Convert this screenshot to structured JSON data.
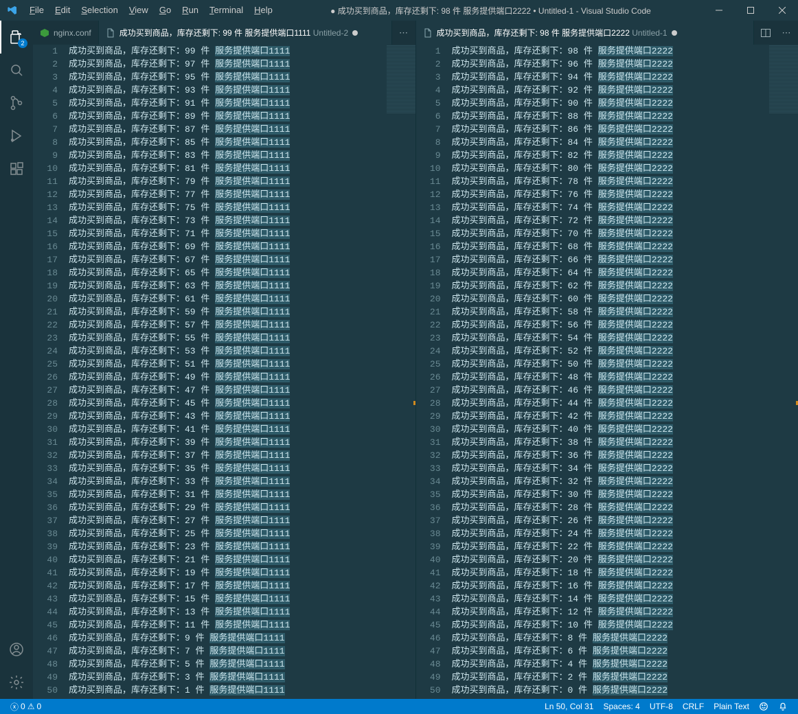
{
  "window": {
    "title_prefix": "● ",
    "title_doc": "成功买到商品，库存还剩下: 98 件 服务提供端口2222 • Untitled-1",
    "app": " - Visual Studio Code"
  },
  "menu": {
    "file": "File",
    "edit": "Edit",
    "selection": "Selection",
    "view": "View",
    "go": "Go",
    "run": "Run",
    "terminal": "Terminal",
    "help": "Help"
  },
  "activity": {
    "explorer_badge": "2"
  },
  "tabs": {
    "left": {
      "nginx": "nginx.conf",
      "active_label": "成功买到商品，库存还剩下: 99 件 服务提供端口1111",
      "active_suffix": "Untitled-2"
    },
    "right": {
      "active_label": "成功买到商品，库存还剩下: 98 件 服务提供端口2222",
      "active_suffix": "Untitled-1"
    }
  },
  "editor": {
    "left": {
      "prefix": "成功买到商品，库存还剩下：",
      "suffix": " 件 ",
      "tail": "服务提供端口1111",
      "start": 99,
      "step": -2,
      "count": 50
    },
    "right": {
      "prefix": "成功买到商品，库存还剩下：",
      "suffix": " 件 ",
      "tail": "服务提供端口2222",
      "start": 98,
      "step": -2,
      "count": 50
    }
  },
  "status": {
    "errors": "0",
    "warnings": "0",
    "lncol": "Ln 50, Col 31",
    "spaces": "Spaces: 4",
    "encoding": "UTF-8",
    "eol": "CRLF",
    "lang": "Plain Text"
  }
}
